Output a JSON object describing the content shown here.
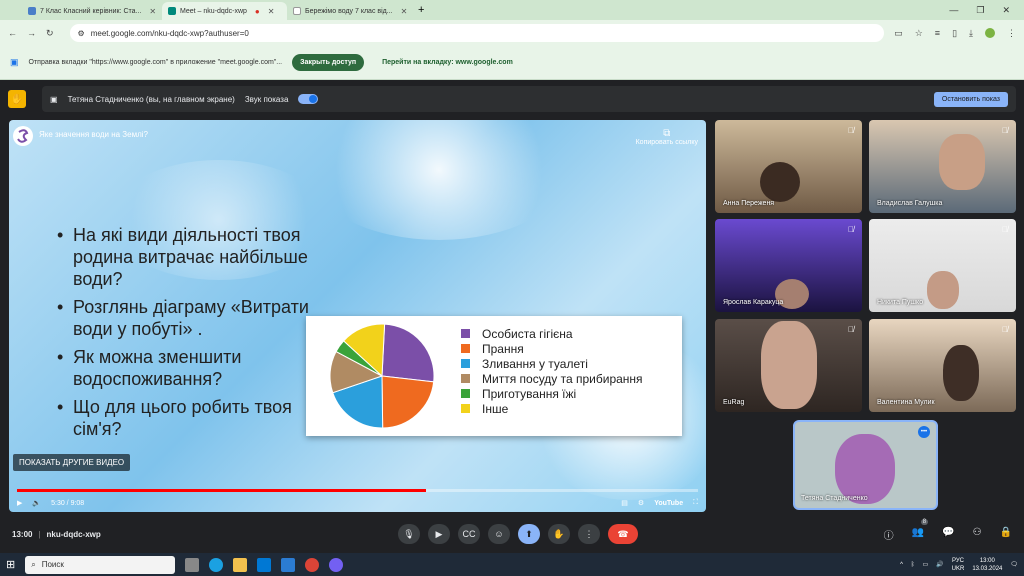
{
  "browser": {
    "tabs": [
      {
        "title": "7 Клас Класний керівник: Ста...",
        "active": false
      },
      {
        "title": "Meet – nku-dqdc-xwp",
        "active": true
      },
      {
        "title": "Бережімо воду 7 клас від...",
        "active": false
      }
    ],
    "url": "meet.google.com/nku-dqdc-xwp?authuser=0"
  },
  "infobar": {
    "message": "Отправка вкладки \"https://www.google.com\" в приложение \"meet.google.com\"...",
    "close_access": "Закрыть доступ",
    "go_to_tab": "Перейти на вкладку: www.google.com"
  },
  "meet_top": {
    "presenter": "Тетяна Стадниченко (вы, на главном экране)",
    "share_audio": "Звук показа",
    "stop_button": "Остановить показ"
  },
  "video": {
    "title": "Яке значення води на Землі?",
    "copy_link": "Копировать ссылку",
    "bullets": [
      "На які види діяльності твоя родина витрачає найбільше води?",
      "Розглянь діаграму «Витрати води у побуті» .",
      "Як можна зменшити водоспоживання?",
      "Що для цього робить твоя сім'я?"
    ],
    "show_other": "ПОКАЗАТЬ ДРУГИЕ ВИДЕО",
    "time": "5:30 / 9:08",
    "progress": 0.6,
    "youtube": "YouTube"
  },
  "chart_data": {
    "type": "pie",
    "categories": [
      "Особиста гігієна",
      "Прання",
      "Зливання у туалеті",
      "Миття посуду та прибирання",
      "Приготування їжі",
      "Інше"
    ],
    "values": [
      26,
      23,
      20,
      13,
      4,
      14
    ],
    "colors": [
      "#7b4fa8",
      "#ef6a1f",
      "#2b9fdc",
      "#b08b63",
      "#3aa33a",
      "#f2d21b"
    ]
  },
  "participants": [
    {
      "name": "Анна Переженя",
      "muted": true
    },
    {
      "name": "Владислав Галушка",
      "muted": true
    },
    {
      "name": "Ярослав Каракуца",
      "muted": true
    },
    {
      "name": "Никита Пушко",
      "muted": true
    },
    {
      "name": "EuRag",
      "muted": true
    },
    {
      "name": "Валентина Мулик",
      "muted": true
    }
  ],
  "self": {
    "name": "Тетяна Стадниченко"
  },
  "bottom": {
    "time": "13:00",
    "meeting_code": "nku-dqdc-xwp",
    "people_count": "8"
  },
  "taskbar": {
    "search": "Поиск",
    "lang": "РУС",
    "lang2": "UKR",
    "clock": "13:00",
    "date": "13.03.2024"
  }
}
